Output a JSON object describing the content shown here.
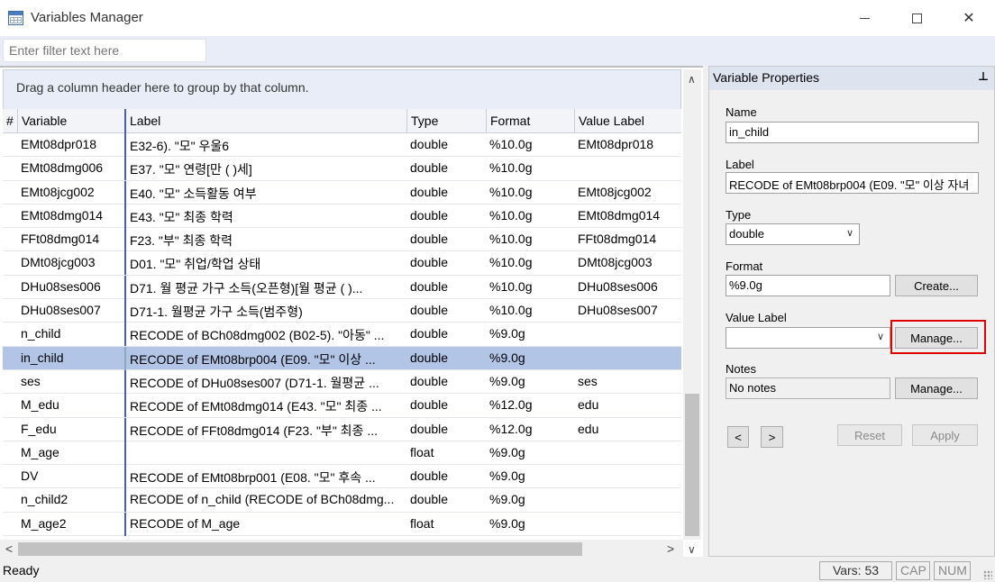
{
  "window": {
    "title": "Variables Manager"
  },
  "filter": {
    "placeholder": "Enter filter text here"
  },
  "grid": {
    "group_hint": "Drag a column header here to group by that column.",
    "columns": {
      "num": "#",
      "variable": "Variable",
      "label": "Label",
      "type": "Type",
      "format": "Format",
      "value_label": "Value Label"
    },
    "rows": [
      {
        "variable": "EMt08dpr018",
        "label": "E32-6). \"모\" 우울6",
        "type": "double",
        "format": "%10.0g",
        "value_label": "EMt08dpr018"
      },
      {
        "variable": "EMt08dmg006",
        "label": "E37. \"모\" 연령[만 ( )세]",
        "type": "double",
        "format": "%10.0g",
        "value_label": ""
      },
      {
        "variable": "EMt08jcg002",
        "label": "E40. \"모\" 소득활동 여부",
        "type": "double",
        "format": "%10.0g",
        "value_label": "EMt08jcg002"
      },
      {
        "variable": "EMt08dmg014",
        "label": "E43. \"모\" 최종 학력",
        "type": "double",
        "format": "%10.0g",
        "value_label": "EMt08dmg014"
      },
      {
        "variable": "FFt08dmg014",
        "label": "F23. \"부\" 최종 학력",
        "type": "double",
        "format": "%10.0g",
        "value_label": "FFt08dmg014"
      },
      {
        "variable": "DMt08jcg003",
        "label": "D01. \"모\" 취업/학업 상태",
        "type": "double",
        "format": "%10.0g",
        "value_label": "DMt08jcg003"
      },
      {
        "variable": "DHu08ses006",
        "label": "D71. 월 평균 가구 소득(오픈형)[월 평균 ( )...",
        "type": "double",
        "format": "%10.0g",
        "value_label": "DHu08ses006"
      },
      {
        "variable": "DHu08ses007",
        "label": "D71-1. 월평균 가구 소득(범주형)",
        "type": "double",
        "format": "%10.0g",
        "value_label": "DHu08ses007"
      },
      {
        "variable": "n_child",
        "label": "RECODE of BCh08dmg002 (B02-5). \"아동\" ...",
        "type": "double",
        "format": "%9.0g",
        "value_label": ""
      },
      {
        "variable": "in_child",
        "label": "RECODE of EMt08brp004 (E09. \"모\" 이상 ...",
        "type": "double",
        "format": "%9.0g",
        "value_label": "",
        "selected": true
      },
      {
        "variable": "ses",
        "label": "RECODE of DHu08ses007 (D71-1. 월평균 ...",
        "type": "double",
        "format": "%9.0g",
        "value_label": "ses"
      },
      {
        "variable": "M_edu",
        "label": "RECODE of EMt08dmg014 (E43. \"모\" 최종 ...",
        "type": "double",
        "format": "%12.0g",
        "value_label": "edu"
      },
      {
        "variable": "F_edu",
        "label": "RECODE of FFt08dmg014 (F23. \"부\" 최종 ...",
        "type": "double",
        "format": "%12.0g",
        "value_label": "edu"
      },
      {
        "variable": "M_age",
        "label": "",
        "type": "float",
        "format": "%9.0g",
        "value_label": ""
      },
      {
        "variable": "DV",
        "label": "RECODE of EMt08brp001 (E08. \"모\" 후속 ...",
        "type": "double",
        "format": "%9.0g",
        "value_label": ""
      },
      {
        "variable": "n_child2",
        "label": "RECODE of n_child (RECODE of BCh08dmg...",
        "type": "double",
        "format": "%9.0g",
        "value_label": ""
      },
      {
        "variable": "M_age2",
        "label": "RECODE of M_age",
        "type": "float",
        "format": "%9.0g",
        "value_label": ""
      }
    ]
  },
  "properties": {
    "title": "Variable Properties",
    "pin_glyph": "⊥",
    "name_label": "Name",
    "name_value": "in_child",
    "label_label": "Label",
    "label_value": "RECODE of EMt08brp004 (E09. \"모\" 이상 자녀",
    "type_label": "Type",
    "type_value": "double",
    "format_label": "Format",
    "format_value": "%9.0g",
    "create_button": "Create...",
    "value_label_label": "Value Label",
    "value_label_value": "",
    "manage_value_label_button": "Manage...",
    "notes_label": "Notes",
    "notes_value": "No notes",
    "manage_notes_button": "Manage...",
    "prev_button": "<",
    "next_button": ">",
    "reset_button": "Reset",
    "apply_button": "Apply"
  },
  "status": {
    "ready": "Ready",
    "vars": "Vars: 53",
    "cap": "CAP",
    "num": "NUM"
  },
  "colors": {
    "selected_row": "#b3c5e6",
    "highlight_box": "#e00000",
    "column_separator": "#4561a8"
  }
}
